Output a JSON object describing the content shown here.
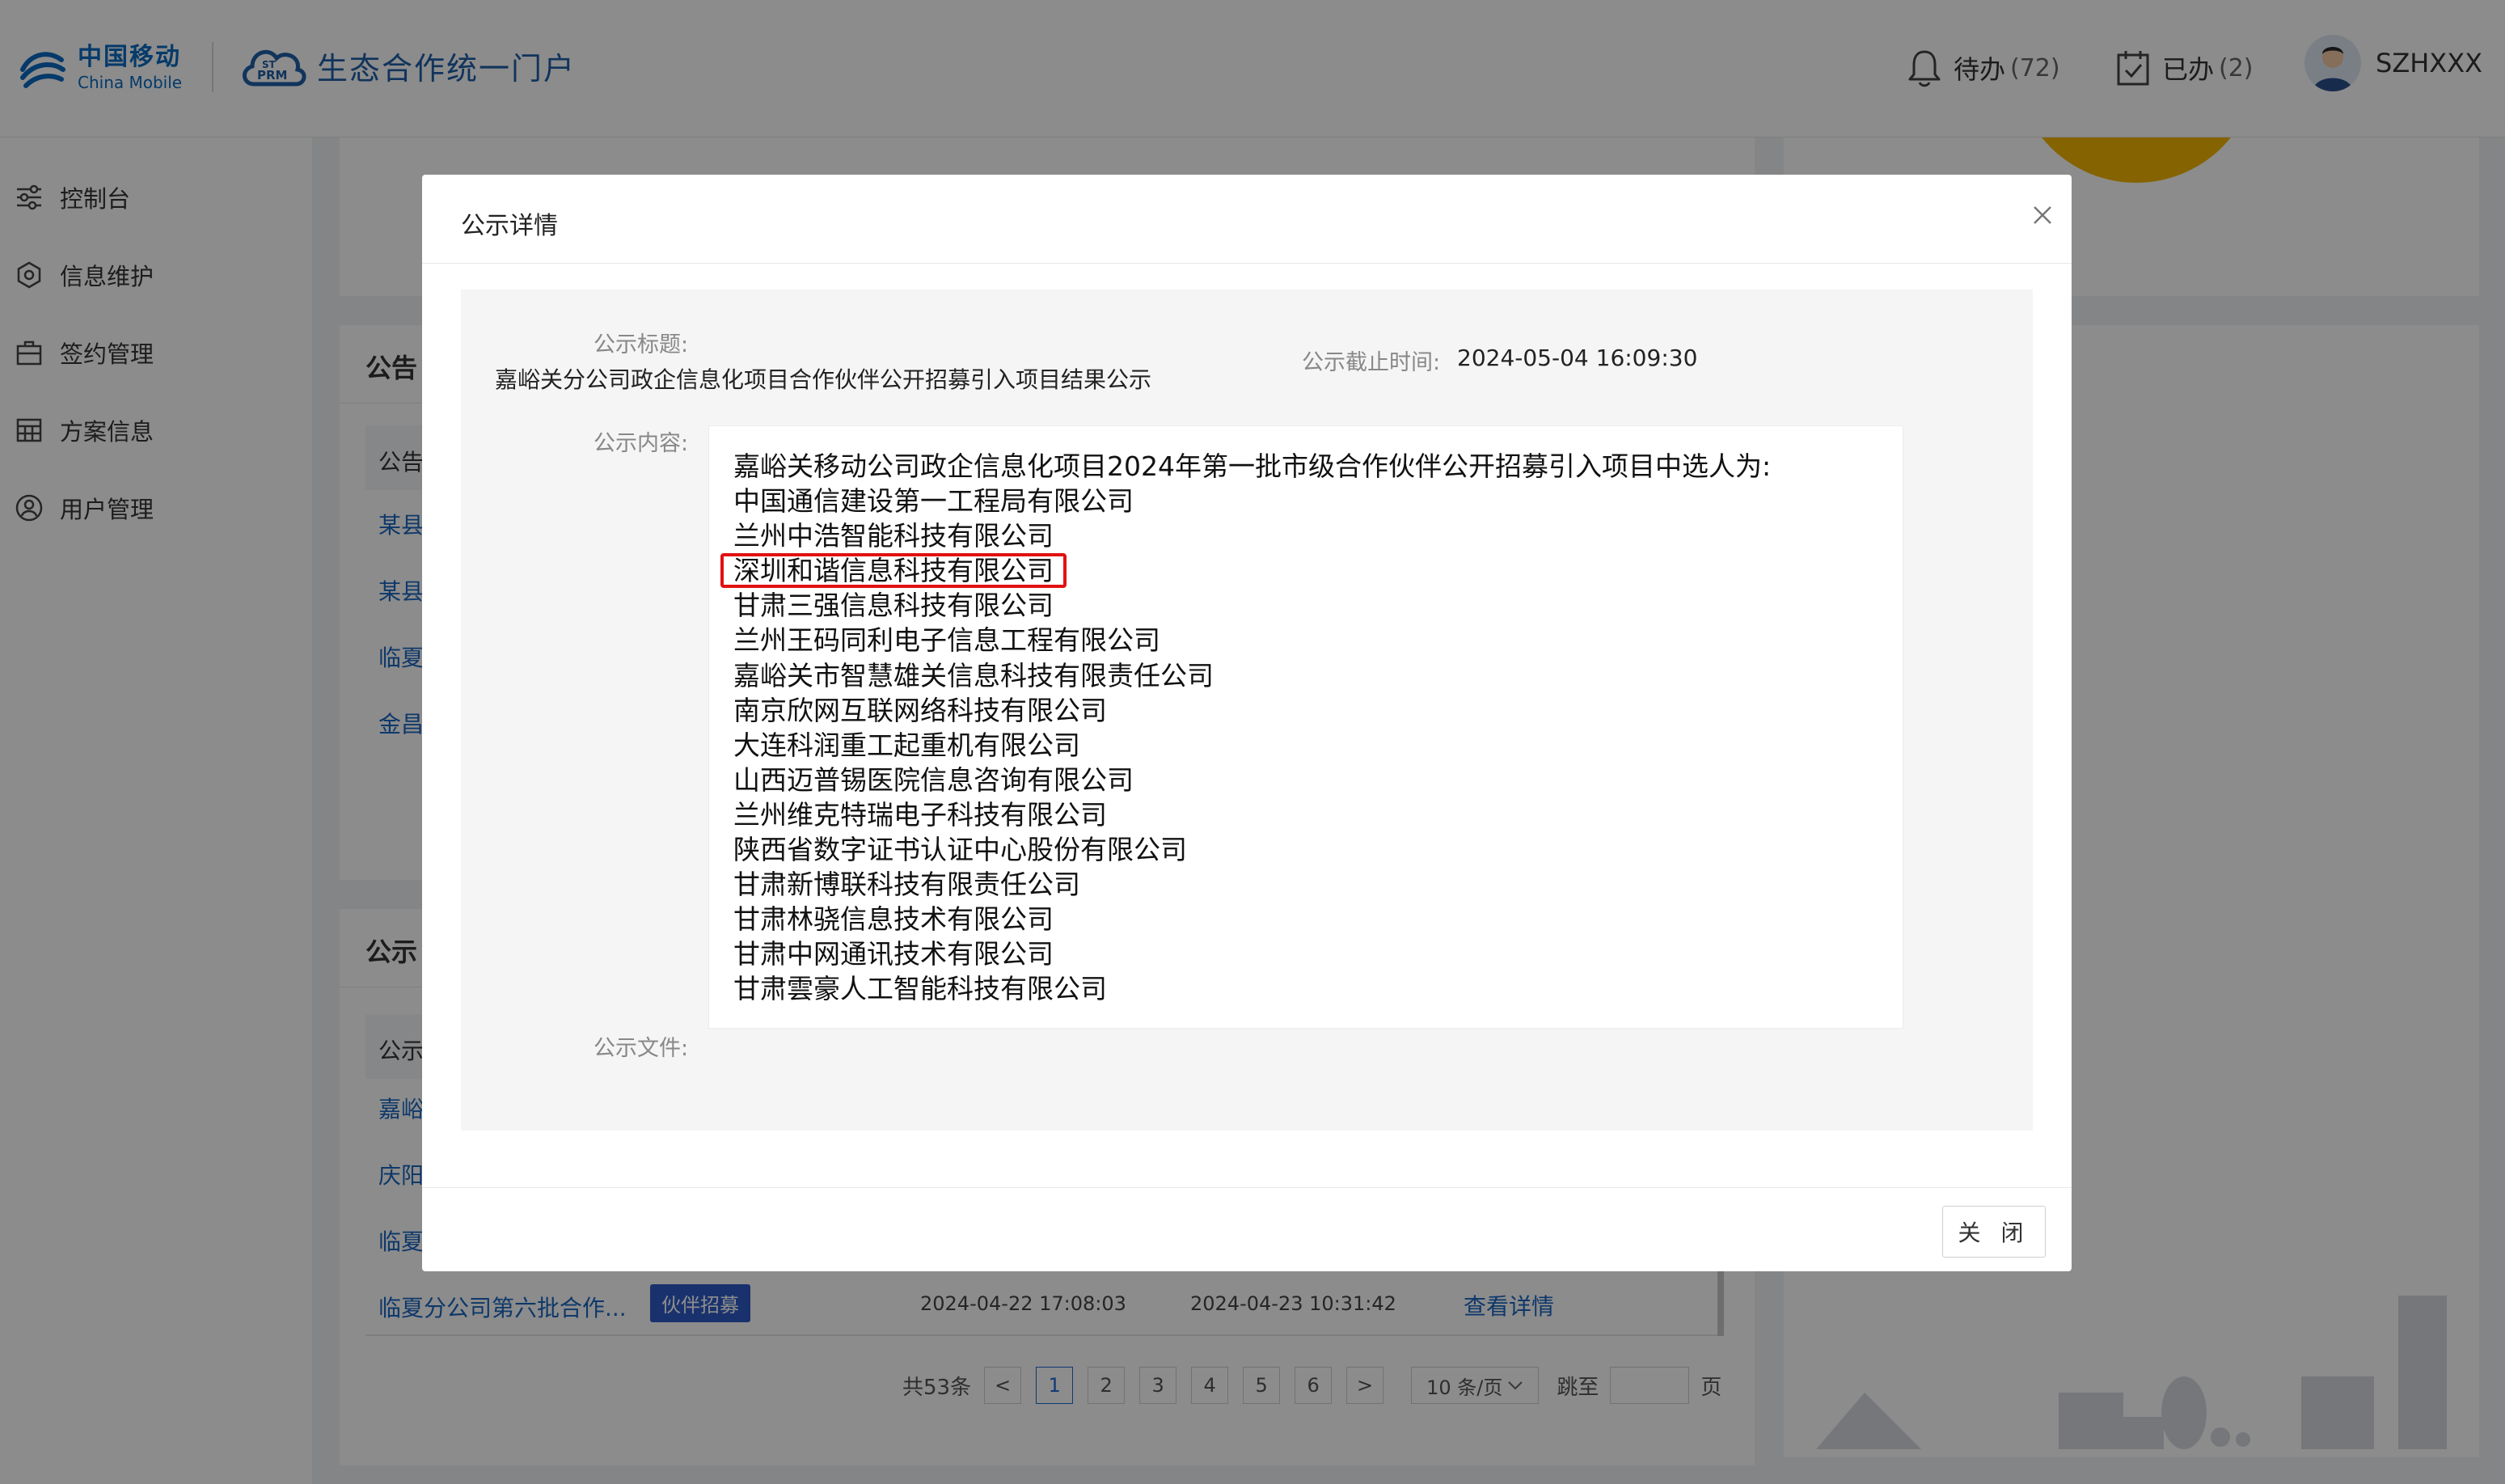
{
  "header": {
    "brand_cn": "中国移动",
    "brand_en": "China Mobile",
    "portal_title": "生态合作统一门户",
    "todo_label": "待办",
    "todo_count": "(72)",
    "done_label": "已办",
    "done_count": "(2)",
    "username": "SZHXXX"
  },
  "sidebar": {
    "items": [
      {
        "label": "控制台",
        "icon": "sliders-icon"
      },
      {
        "label": "信息维护",
        "icon": "hexagon-icon"
      },
      {
        "label": "签约管理",
        "icon": "briefcase-icon"
      },
      {
        "label": "方案信息",
        "icon": "grid-table-icon"
      },
      {
        "label": "用户管理",
        "icon": "user-circle-icon"
      }
    ]
  },
  "background": {
    "announce_panel": {
      "title": "公告",
      "column_header": "公告",
      "rows": [
        "某县",
        "某县",
        "临夏",
        "金昌"
      ]
    },
    "publicity_panel": {
      "title": "公示",
      "column_header": "公示",
      "rows": [
        "嘉峪",
        "庆阳",
        "临夏"
      ],
      "last_row": {
        "title": "临夏分公司第六批合作...",
        "tag": "伙伴招募",
        "start": "2024-04-22 17:08:03",
        "end": "2024-04-23 10:31:42",
        "action": "查看详情"
      }
    },
    "pagination": {
      "total": "共53条",
      "prev": "<",
      "pages": [
        "1",
        "2",
        "3",
        "4",
        "5",
        "6"
      ],
      "current": "1",
      "next": ">",
      "page_size": "10 条/页",
      "jump_label": "跳至",
      "page_unit": "页"
    }
  },
  "modal": {
    "title": "公示详情",
    "close_icon": "close-icon",
    "title_label": "公示标题:",
    "title_value": "嘉峪关分公司政企信息化项目合作伙伴公开招募引入项目结果公示",
    "deadline_label": "公示截止时间:",
    "deadline_value": "2024-05-04 16:09:30",
    "content_label": "公示内容:",
    "content_lines": [
      "嘉峪关移动公司政企信息化项目2024年第一批市级合作伙伴公开招募引入项目中选人为:",
      "中国通信建设第一工程局有限公司",
      "兰州中浩智能科技有限公司",
      "深圳和谐信息科技有限公司",
      "甘肃三强信息科技有限公司",
      "兰州王码同利电子信息工程有限公司",
      "嘉峪关市智慧雄关信息科技有限责任公司",
      "南京欣网互联网络科技有限公司",
      "大连科润重工起重机有限公司",
      "山西迈普锡医院信息咨询有限公司",
      "兰州维克特瑞电子科技有限公司",
      "陕西省数字证书认证中心股份有限公司",
      "甘肃新博联科技有限责任公司",
      "甘肃林骁信息技术有限公司",
      "甘肃中网通讯技术有限公司",
      "甘肃雲豪人工智能科技有限公司"
    ],
    "highlighted_line_index": 3,
    "highlight_color": "#e11111",
    "file_label": "公示文件:",
    "close_button": "关 闭"
  },
  "colors": {
    "brand_blue": "#0a6bc1",
    "link_blue": "#1a66c2",
    "tag_blue": "#2f5bc8",
    "accent_yellow": "#f3b400"
  }
}
